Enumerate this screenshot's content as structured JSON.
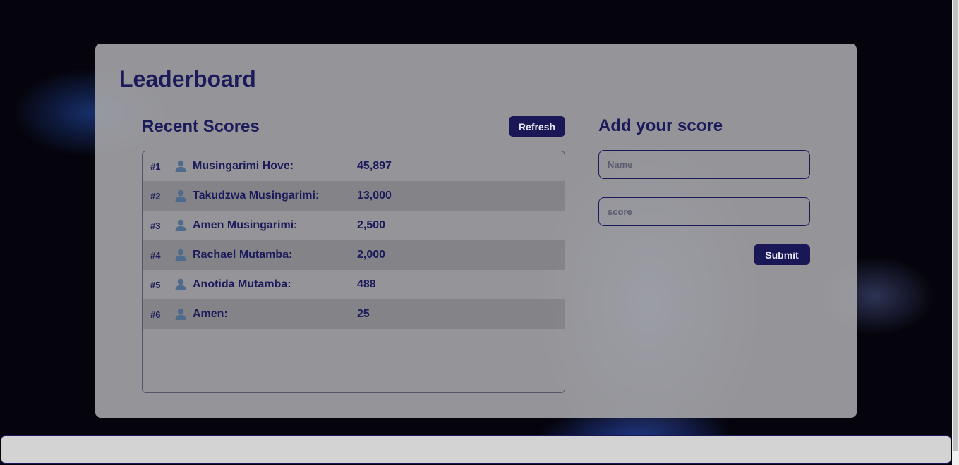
{
  "leaderboard": {
    "title": "Leaderboard",
    "recent": {
      "title": "Recent Scores",
      "refresh_label": "Refresh",
      "rows": [
        {
          "rank": "#1",
          "name": "Musingarimi Hove:",
          "score": "45,897"
        },
        {
          "rank": "#2",
          "name": "Takudzwa Musingarimi:",
          "score": "13,000"
        },
        {
          "rank": "#3",
          "name": "Amen Musingarimi:",
          "score": "2,500"
        },
        {
          "rank": "#4",
          "name": "Rachael Mutamba:",
          "score": "2,000"
        },
        {
          "rank": "#5",
          "name": "Anotida Mutamba:",
          "score": "488"
        },
        {
          "rank": "#6",
          "name": "Amen:",
          "score": "25"
        }
      ]
    },
    "add": {
      "title": "Add your score",
      "name_placeholder": "Name",
      "score_placeholder": "score",
      "submit_label": "Submit"
    }
  },
  "colors": {
    "accent": "#1a1756",
    "text": "#1b1a5a",
    "icon": "#4e6a8c"
  },
  "icons": {
    "user": "user-icon"
  }
}
